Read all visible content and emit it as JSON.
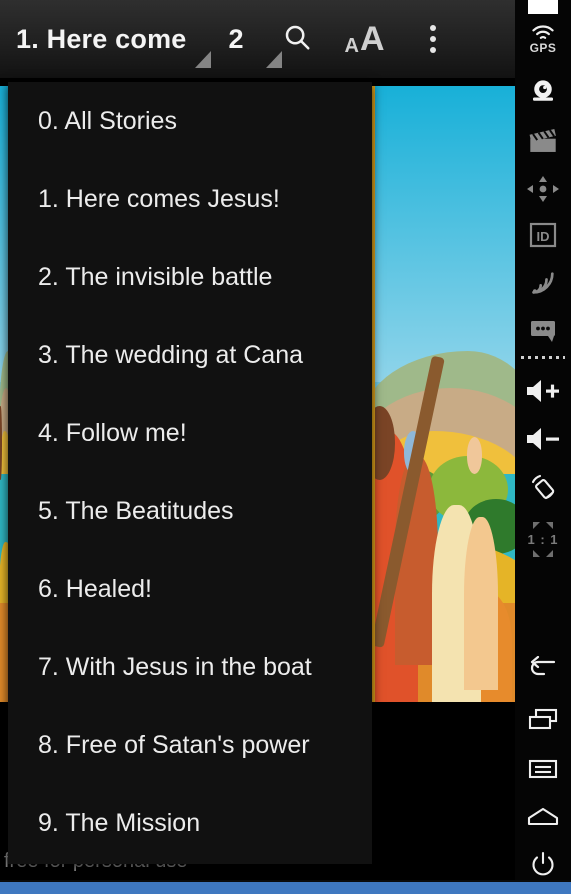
{
  "app": {
    "toolbar": {
      "title": "1. Here come",
      "page_number": "2",
      "search_icon": "search-icon",
      "font_size_icon_small": "A",
      "font_size_icon_large": "A",
      "overflow_icon": "more-vertical-icon"
    },
    "story_menu": {
      "items": [
        {
          "label": "0. All Stories"
        },
        {
          "label": "1. Here comes Jesus!"
        },
        {
          "label": "2. The invisible battle"
        },
        {
          "label": "3. The wedding at Cana"
        },
        {
          "label": "4. Follow me!"
        },
        {
          "label": "5. The Beatitudes"
        },
        {
          "label": "6. Healed!"
        },
        {
          "label": "7. With Jesus in the boat"
        },
        {
          "label": "8. Free of Satan's power"
        },
        {
          "label": "9. The Mission"
        }
      ]
    },
    "caption": "free for personal use"
  },
  "sidebar": {
    "items": [
      {
        "name": "gps-icon",
        "label": "GPS"
      },
      {
        "name": "camera-icon",
        "label": ""
      },
      {
        "name": "movie-clapper-icon",
        "label": ""
      },
      {
        "name": "dpad-icon",
        "label": ""
      },
      {
        "name": "id-badge-icon",
        "label": "ID"
      },
      {
        "name": "rss-signal-icon",
        "label": ""
      },
      {
        "name": "chat-bubble-icon",
        "label": ""
      },
      {
        "name": "volume-up-icon",
        "label": ""
      },
      {
        "name": "volume-down-icon",
        "label": ""
      },
      {
        "name": "rotation-lock-icon",
        "label": ""
      },
      {
        "name": "scale-one-to-one-icon",
        "label": "1 : 1"
      },
      {
        "name": "back-icon",
        "label": ""
      },
      {
        "name": "recent-apps-icon",
        "label": ""
      },
      {
        "name": "menu-icon",
        "label": ""
      },
      {
        "name": "home-icon",
        "label": ""
      },
      {
        "name": "power-icon",
        "label": ""
      }
    ]
  },
  "colors": {
    "toolbar_bg": "#202020",
    "menu_bg": "#111111",
    "menu_text": "#ececec",
    "sidebar_bg": "#050505",
    "accent_strip": "#3f78c0",
    "page_border": "#e8a81c",
    "sky": "#18b0d8",
    "water": "#2fb8c4"
  }
}
